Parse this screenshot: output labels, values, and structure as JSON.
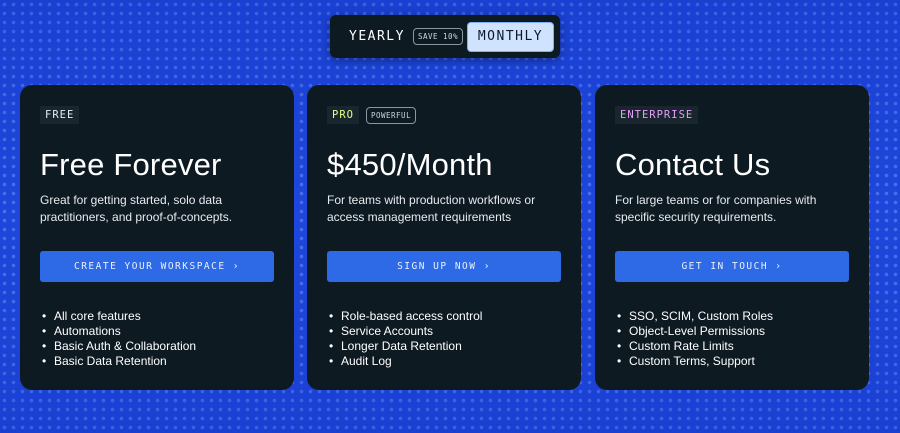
{
  "toggle": {
    "yearly_label": "YEARLY",
    "save_badge": "SAVE 10%",
    "monthly_label": "MONTHLY",
    "selected": "MONTHLY"
  },
  "plans": [
    {
      "tier": "FREE",
      "title": "Free Forever",
      "description": "Great for getting started, solo data practitioners, and proof-of-concepts.",
      "cta": "CREATE YOUR WORKSPACE ›",
      "features": [
        "All core features",
        "Automations",
        "Basic Auth & Collaboration",
        "Basic Data Retention"
      ]
    },
    {
      "tier": "PRO",
      "badge": "POWERFUL",
      "title": "$450/Month",
      "description": "For teams with production workflows or access management requirements",
      "cta": "SIGN UP NOW ›",
      "features": [
        "Role-based access control",
        "Service Accounts",
        "Longer Data Retention",
        "Audit Log"
      ]
    },
    {
      "tier": "ENTERPRISE",
      "title": "Contact Us",
      "description": "For large teams or for companies with specific security requirements.",
      "cta": "GET IN TOUCH ›",
      "features": [
        "SSO, SCIM, Custom Roles",
        "Object-Level Permissions",
        "Custom Rate Limits",
        "Custom Terms, Support"
      ]
    }
  ],
  "colors": {
    "background": "#1d45d8",
    "card": "#0e1a22",
    "cta": "#2f6ae6",
    "pro_tag": "#e6ff8a",
    "enterprise_tag": "#e89cff",
    "toggle_selected": "#cfe3ff"
  }
}
